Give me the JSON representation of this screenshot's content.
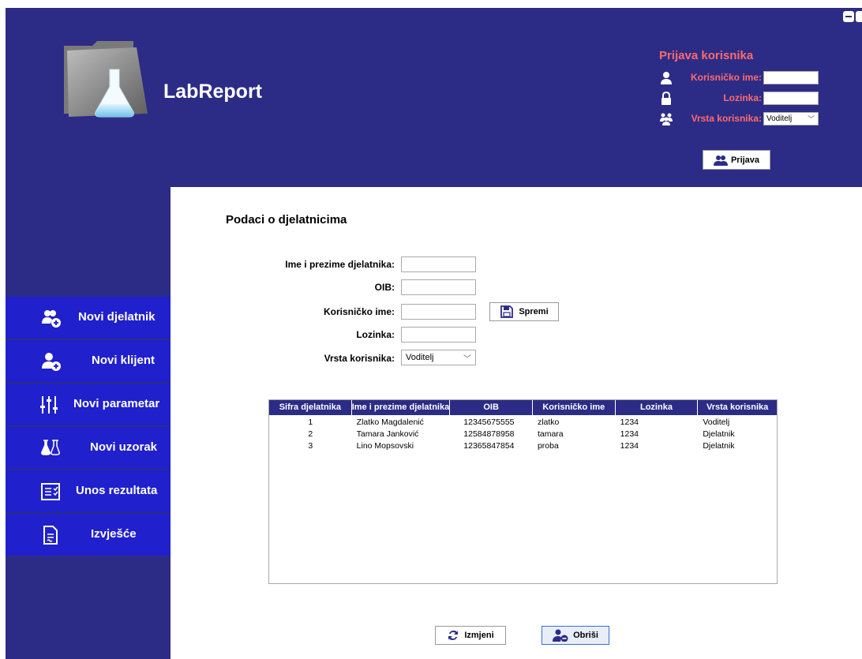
{
  "app": {
    "title": "LabReport"
  },
  "login": {
    "title": "Prijava korisnika",
    "username_label": "Korisničko ime:",
    "password_label": "Lozinka:",
    "usertype_label": "Vrsta korisnika:",
    "usertype_value": "Voditelj",
    "submit_label": "Prijava"
  },
  "sidebar": {
    "items": [
      {
        "label": "Novi djelatnik"
      },
      {
        "label": "Novi klijent"
      },
      {
        "label": "Novi parametar"
      },
      {
        "label": "Novi uzorak"
      },
      {
        "label": "Unos rezultata"
      },
      {
        "label": "Izvješće"
      }
    ]
  },
  "form": {
    "title": "Podaci o djelatnicima",
    "name_label": "Ime i prezime djelatnika:",
    "oib_label": "OIB:",
    "username_label": "Korisničko ime:",
    "password_label": "Lozinka:",
    "type_label": "Vrsta korisnika:",
    "type_value": "Voditelj",
    "save_label": "Spremi"
  },
  "table": {
    "columns": [
      "Sifra djelatnika",
      "Ime i prezime djelatnika",
      "OIB",
      "Korisničko ime",
      "Lozinka",
      "Vrsta korisnika"
    ],
    "rows": [
      [
        "1",
        "Zlatko Magdalenić",
        "12345675555",
        "zlatko",
        "1234",
        "Voditelj"
      ],
      [
        "2",
        "Tamara Janković",
        "12584878958",
        "tamara",
        "1234",
        "Djelatnik"
      ],
      [
        "3",
        "Lino Mopsovski",
        "12365847854",
        "proba",
        "1234",
        "Djelatnik"
      ]
    ]
  },
  "actions": {
    "edit_label": "Izmjeni",
    "delete_label": "Obriši"
  },
  "colors": {
    "header_bg": "#2c2c87",
    "nav_bg": "#2020cc",
    "accent_red": "#ff6b6b"
  }
}
